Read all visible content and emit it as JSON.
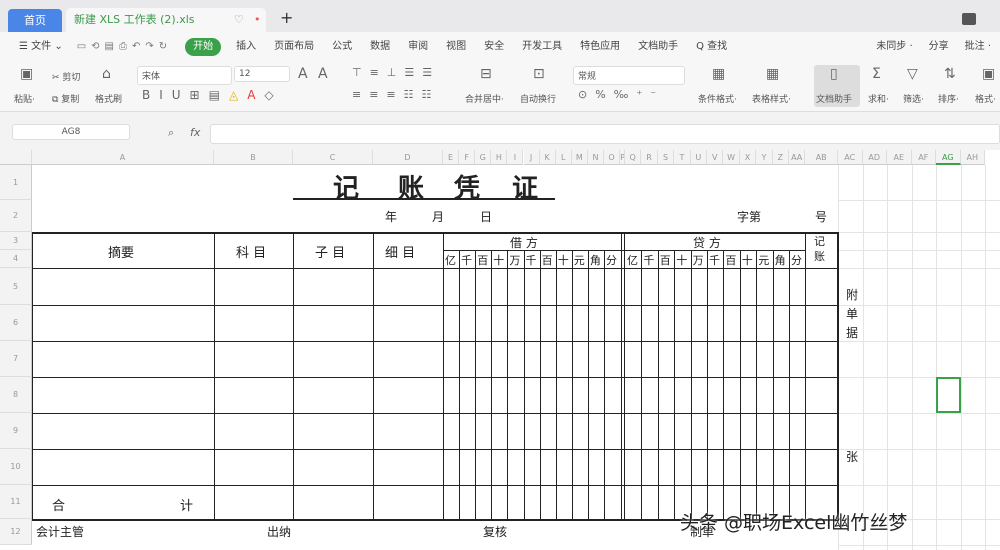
{
  "tabs": {
    "home": "首页",
    "doc": "新建 XLS 工作表 (2).xls",
    "new": "+"
  },
  "menu": {
    "file": "☰ 文件 ⌄",
    "items": [
      "开始",
      "插入",
      "页面布局",
      "公式",
      "数据",
      "审阅",
      "视图",
      "安全",
      "开发工具",
      "特色应用",
      "文档助手",
      "Q 查找"
    ],
    "active": 0,
    "right": [
      "未同步 ·",
      "分享",
      "批注 ·"
    ]
  },
  "ribbon": {
    "paste": "粘贴·",
    "cut": "剪切",
    "copy": "复制",
    "format_painter": "格式刷",
    "font": "宋体",
    "font_size": "12",
    "merge": "合并居中·",
    "wrap": "自动换行",
    "number_format": "常规",
    "cond_format": "条件格式·",
    "table_style": "表格样式·",
    "doc_helper": "文档助手",
    "sum": "求和·",
    "filter": "筛选·",
    "sort": "排序·",
    "format": "格式·"
  },
  "formula_bar": {
    "cell_ref": "AG8",
    "fx": "fx",
    "value": ""
  },
  "columns": [
    "A",
    "B",
    "C",
    "D",
    "E",
    "F",
    "G",
    "H",
    "I",
    "J",
    "K",
    "L",
    "M",
    "N",
    "O",
    "P",
    "Q",
    "R",
    "S",
    "T",
    "U",
    "V",
    "W",
    "X",
    "Y",
    "Z",
    "AA",
    "AB",
    "AC",
    "AD",
    "AE",
    "AF",
    "AG",
    "AH"
  ],
  "selected_column": "AG",
  "rows": [
    "1",
    "2",
    "3",
    "4",
    "5",
    "6",
    "7",
    "8",
    "9",
    "10",
    "11",
    "12"
  ],
  "voucher": {
    "title": [
      "记",
      "账",
      "凭",
      "证"
    ],
    "year": "年",
    "month": "月",
    "day": "日",
    "word_no": "字第",
    "no": "号",
    "headers": {
      "summary": "摘要",
      "account": "科 目",
      "sub_account": "子 目",
      "detail": "细 目",
      "debit": "借 方",
      "credit": "贷 方",
      "posted": "记账"
    },
    "digits": [
      "亿",
      "千",
      "百",
      "十",
      "万",
      "千",
      "百",
      "十",
      "元",
      "角",
      "分"
    ],
    "attachments": "附单据",
    "sheets": "张",
    "total_left": "合",
    "total_right": "计",
    "footer": {
      "supervisor": "会计主管",
      "cashier": "出纳",
      "reviewer": "复核",
      "maker": "制单"
    }
  },
  "watermark": "头条 @职场Excel幽竹丝梦",
  "accent": "#3aa04a"
}
